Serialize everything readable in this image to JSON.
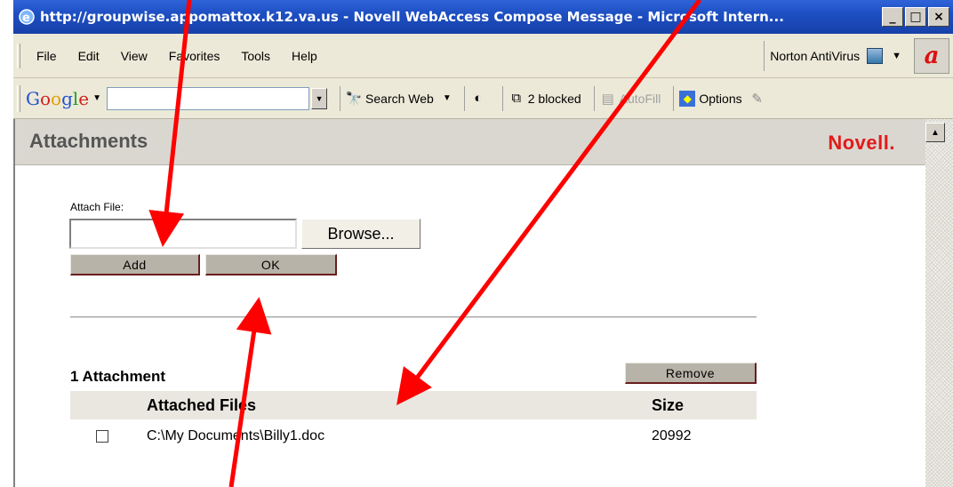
{
  "window": {
    "title": "http://groupwise.appomattox.k12.va.us - Novell WebAccess Compose Message - Microsoft Intern...",
    "buttons": {
      "minimize": "_",
      "maximize": "□",
      "close": "×"
    }
  },
  "menubar": {
    "items": [
      "File",
      "Edit",
      "View",
      "Favorites",
      "Tools",
      "Help"
    ],
    "norton_label": "Norton AntiVirus"
  },
  "google_toolbar": {
    "search_web": "Search Web",
    "blocked": "2 blocked",
    "autofill": "AutoFill",
    "options": "Options"
  },
  "page": {
    "header_title": "Attachments",
    "brand": "Novell.",
    "attach_label": "Attach File:",
    "file_value": "",
    "browse": "Browse...",
    "add": "Add",
    "ok": "OK",
    "attachment_count": "1 Attachment",
    "remove": "Remove",
    "table": {
      "headers": {
        "files": "Attached Files",
        "size": "Size"
      },
      "rows": [
        {
          "file": "C:\\My Documents\\Billy1.doc",
          "size": "20992",
          "checked": false
        }
      ]
    }
  },
  "colors": {
    "annotation_arrow": "#ff0000",
    "brand": "#e21a1a",
    "titlebar": "#1d4fc3"
  }
}
